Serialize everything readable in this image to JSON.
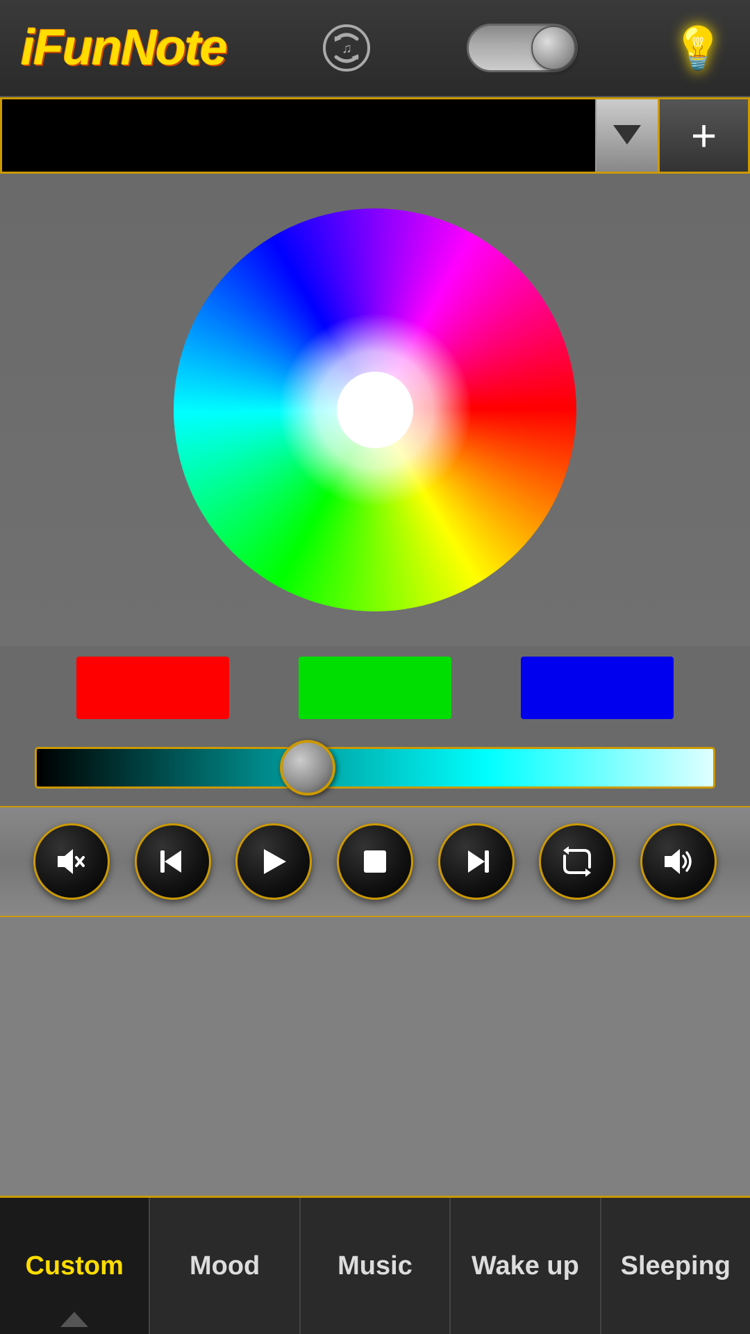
{
  "header": {
    "title_1": "iFun",
    "title_2": "Note",
    "toggle_state": "on"
  },
  "dropdown": {
    "placeholder": "",
    "add_label": "+"
  },
  "rgb_swatches": {
    "red": "#ff0000",
    "green": "#00dd00",
    "blue": "#0000ee"
  },
  "media_controls": {
    "volume_down": "🔉",
    "prev": "⏮",
    "play": "▶",
    "stop": "⏹",
    "next": "⏭",
    "repeat": "🔁",
    "volume_up": "🔊"
  },
  "tabs": [
    {
      "id": "custom",
      "label": "Custom",
      "active": true
    },
    {
      "id": "mood",
      "label": "Mood",
      "active": false
    },
    {
      "id": "music",
      "label": "Music",
      "active": false
    },
    {
      "id": "wakeup",
      "label": "Wake up",
      "active": false
    },
    {
      "id": "sleeping",
      "label": "Sleeping",
      "active": false
    }
  ],
  "colors": {
    "accent": "#cc9900",
    "active_tab_text": "#ffdd00"
  }
}
